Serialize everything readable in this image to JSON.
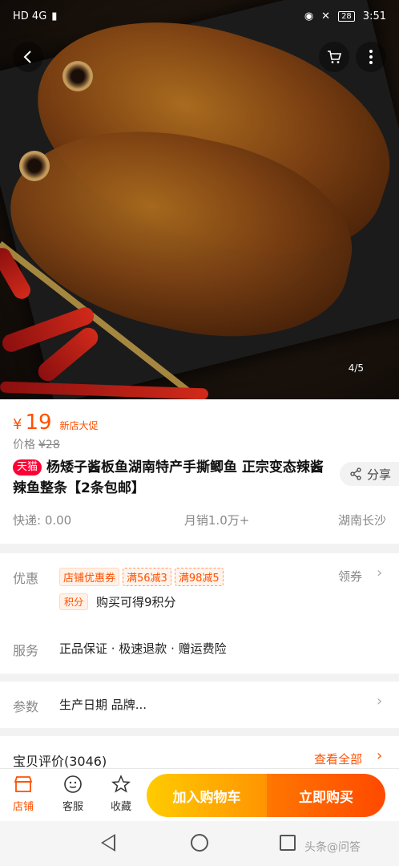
{
  "status_bar": {
    "network": "HD 4G",
    "battery": "28",
    "time": "3:51"
  },
  "hero": {
    "image_counter": "4/5"
  },
  "price": {
    "currency": "¥",
    "value": "19",
    "promo_tag": "新店大促",
    "original_label": "价格",
    "original_price": "¥28"
  },
  "product": {
    "badge": "天猫",
    "title": "杨矮子酱板鱼湖南特产手撕鲫鱼 正宗变态辣酱辣鱼整条【2条包邮】",
    "share_label": "分享",
    "shipping": "快递: 0.00",
    "sales": "月销1.0万+",
    "location": "湖南长沙"
  },
  "promo": {
    "label": "优惠",
    "coupons": [
      "店铺优惠券",
      "满56减3",
      "满98减5"
    ],
    "claim_label": "领券",
    "points_badge": "积分",
    "points_text": "购买可得9积分"
  },
  "service": {
    "label": "服务",
    "text": "正品保证 · 极速退款 · 赠运费险"
  },
  "params": {
    "label": "参数",
    "text": "生产日期 品牌..."
  },
  "reviews": {
    "title": "宝贝评价(3046)",
    "view_all": "查看全部"
  },
  "actions": {
    "shop": "店铺",
    "service": "客服",
    "favorite": "收藏",
    "add_cart": "加入购物车",
    "buy_now": "立即购买"
  },
  "watermark": "头条@问答",
  "colors": {
    "accent": "#ff5000",
    "tmall": "#ff0036",
    "cart_gradient": [
      "#ffcb00",
      "#ff9402"
    ],
    "buy_gradient": [
      "#ff7700",
      "#ff4900"
    ]
  }
}
